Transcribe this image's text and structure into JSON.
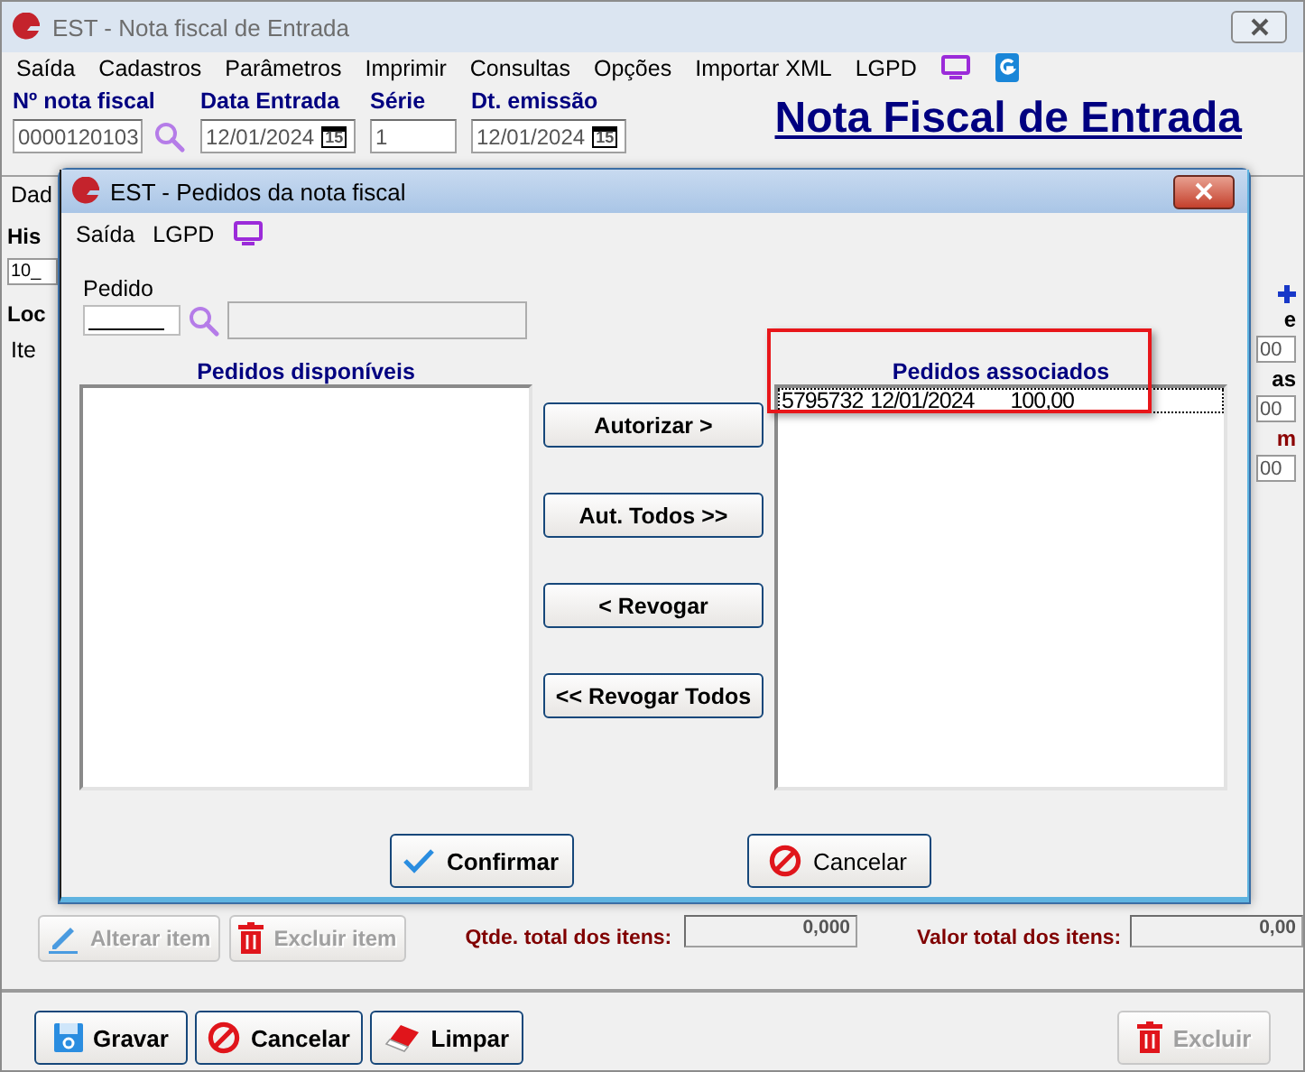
{
  "window": {
    "title": "EST - Nota fiscal de Entrada"
  },
  "menu": [
    {
      "label": "Saída"
    },
    {
      "label": "Cadastros"
    },
    {
      "label": "Parâmetros"
    },
    {
      "label": "Imprimir"
    },
    {
      "label": "Consultas"
    },
    {
      "label": "Opções"
    },
    {
      "label": "Importar XML"
    },
    {
      "label": "LGPD"
    }
  ],
  "header_fields": [
    {
      "label": "Nº nota fiscal",
      "value": "0000120103",
      "kind": "search"
    },
    {
      "label": "Data Entrada",
      "value": "12/01/2024",
      "kind": "date",
      "calendar_label": "15"
    },
    {
      "label": "Série",
      "value": "1",
      "kind": "text"
    },
    {
      "label": "Dt. emissão",
      "value": "12/01/2024",
      "kind": "date",
      "calendar_label": "15"
    }
  ],
  "page_title": "Nota Fiscal de Entrada",
  "left_fragments": [
    {
      "text": "Dad",
      "kind": "tab"
    },
    {
      "text": "His",
      "kind": "label"
    },
    {
      "text": "10_",
      "kind": "field"
    },
    {
      "text": "Loc",
      "kind": "label"
    },
    {
      "text": "Ite",
      "kind": "tab"
    }
  ],
  "right_fragments": [
    {
      "text": "e",
      "kind": "label"
    },
    {
      "text": "00",
      "kind": "field"
    },
    {
      "text": "as",
      "kind": "label"
    },
    {
      "text": "00",
      "kind": "field"
    },
    {
      "text": "m",
      "kind": "alert"
    },
    {
      "text": "00",
      "kind": "field"
    }
  ],
  "item_actions": [
    {
      "label": "Alterar item",
      "disabled": true
    },
    {
      "label": "Excluir item",
      "disabled": true
    }
  ],
  "totals": [
    {
      "label": "Qtde. total dos itens:",
      "value": "0,000"
    },
    {
      "label": "Valor total dos itens:",
      "value": "0,00"
    }
  ],
  "footer_buttons": [
    {
      "label": "Gravar",
      "disabled": false
    },
    {
      "label": "Cancelar",
      "disabled": false
    },
    {
      "label": "Limpar",
      "disabled": false
    },
    {
      "label": "Excluir",
      "disabled": true
    }
  ],
  "dialog": {
    "title": "EST - Pedidos da nota fiscal",
    "menu": [
      {
        "label": "Saída"
      },
      {
        "label": "LGPD"
      }
    ],
    "order_label": "Pedido",
    "available": {
      "title": "Pedidos disponíveis"
    },
    "associated": {
      "title": "Pedidos associados",
      "highlighted": true,
      "rows": [
        {
          "number": "5795732",
          "date": "12/01/2024",
          "value": "100,00",
          "selected": true
        }
      ]
    },
    "transfer_buttons": [
      {
        "label": "Autorizar >"
      },
      {
        "label": "Aut. Todos >>"
      },
      {
        "label": "< Revogar"
      },
      {
        "label": "<< Revogar Todos"
      }
    ],
    "actions": [
      {
        "label": "Confirmar"
      },
      {
        "label": "Cancelar"
      }
    ]
  }
}
